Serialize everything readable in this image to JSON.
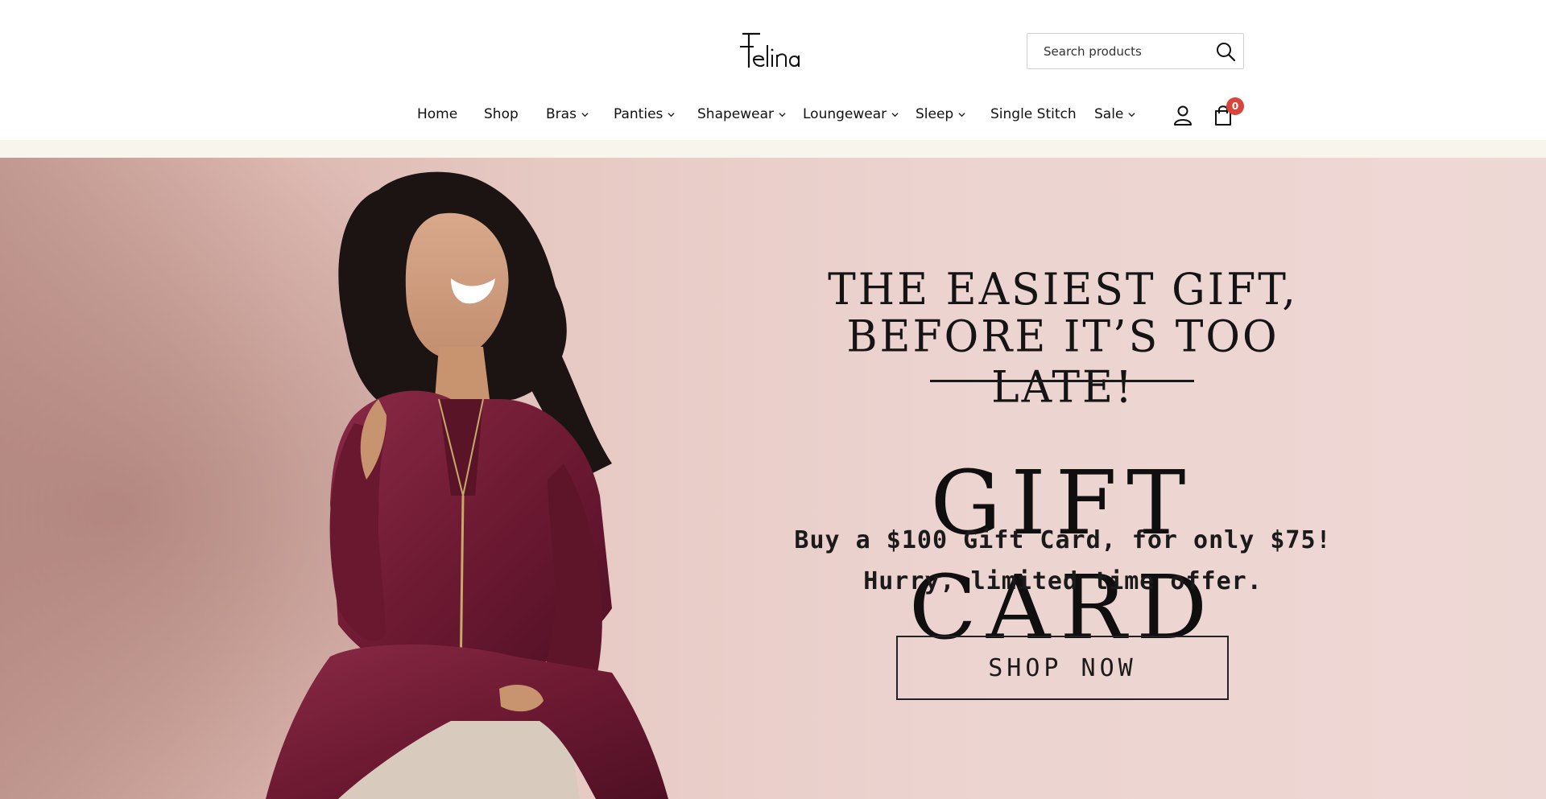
{
  "brand": {
    "logo_text": "Felina"
  },
  "search": {
    "placeholder": "Search products",
    "value": ""
  },
  "nav": {
    "items": [
      {
        "label": "Home",
        "has_dropdown": false
      },
      {
        "label": "Shop",
        "has_dropdown": false
      },
      {
        "label": "Bras",
        "has_dropdown": true
      },
      {
        "label": "Panties",
        "has_dropdown": true
      },
      {
        "label": "Shapewear",
        "has_dropdown": true
      },
      {
        "label": "Loungewear",
        "has_dropdown": true
      },
      {
        "label": "Sleep",
        "has_dropdown": true
      },
      {
        "label": "Single Stitch",
        "has_dropdown": false
      },
      {
        "label": "Sale",
        "has_dropdown": true
      }
    ]
  },
  "cart": {
    "count": "0"
  },
  "icons": {
    "search": "search-icon",
    "account": "user-icon",
    "cart": "shopping-bag-icon",
    "dropdown": "chevron-down-icon"
  },
  "hero": {
    "headline_line1": "THE EASIEST GIFT,",
    "headline_line2": "BEFORE IT’S TOO LATE!",
    "title": "GIFT CARD",
    "offer_line1": "Buy a $100 Gift Card, for only $75!",
    "offer_line2": "Hurry, limited time offer.",
    "cta_label": "SHOP NOW"
  },
  "colors": {
    "badge": "#d9443b",
    "hero_background": "#ecd3cf",
    "outfit": "#6e1a33",
    "announcement_strip": "#f8f5ec"
  }
}
